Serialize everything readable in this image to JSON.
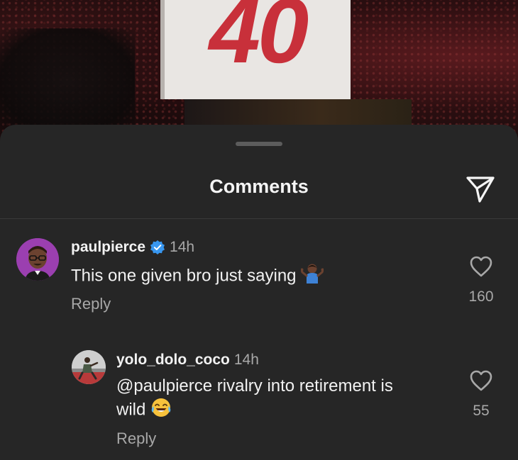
{
  "background": {
    "banner_number": "40"
  },
  "sheet": {
    "title": "Comments"
  },
  "comments": [
    {
      "username": "paulpierce",
      "verified": true,
      "time": "14h",
      "text": "This one given bro just saying",
      "emoji": "person-shrugging",
      "reply_label": "Reply",
      "likes": "160"
    },
    {
      "username": "yolo_dolo_coco",
      "verified": false,
      "time": "14h",
      "text_line1": "@paulpierce rivalry into retirement is",
      "text_line2": "wild",
      "emoji": "face-with-tears-of-joy",
      "reply_label": "Reply",
      "likes": "55"
    }
  ],
  "colors": {
    "sheet_bg": "#262626",
    "primary_text": "#f2f2f2",
    "secondary_text": "#a8a8a8",
    "verified_blue": "#3897f0",
    "banner_red": "#c8303a"
  }
}
